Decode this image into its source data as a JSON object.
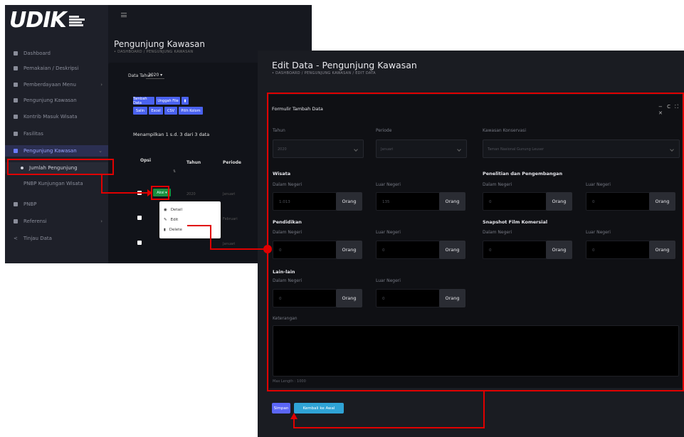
{
  "colors": {
    "accent": "#4a62f0",
    "annotation": "#e00000",
    "success": "#1a8f3e",
    "info": "#2fa3d6",
    "primary": "#5b66f5"
  },
  "bg": {
    "logo": "UDIK",
    "sidebar": [
      "Dashboard",
      "Pemakaian / Deskripsi",
      "Pemberdayaan Menu",
      "Pengunjung Kawasan",
      "Kontrib Masuk Wisata",
      "Fasilitas",
      "Pengunjung Kawasan",
      "Jumlah Pengunjung",
      "PNBP Kunjungan Wisata",
      "PNBP",
      "Referensi",
      "Tinjau Data"
    ],
    "page_title": "Pengunjung Kawasan",
    "breadcrumb": "• DASHBOARD / PENGUNJUNG KAWASAN",
    "year_label": "Data Tahun",
    "year_value": "2020 ▾",
    "buttons_row1": [
      "Tambah Data",
      "Unggah File"
    ],
    "buttons_row2": [
      "Salin",
      "Excel",
      "CSV",
      "Pilih Kolom"
    ],
    "showing": "Menampilkan 1 s.d. 3 dari 3 data",
    "table_headers": [
      "Opsi",
      "Tahun",
      "Periode"
    ],
    "aksi": "Aksi ▾",
    "dropdown": [
      {
        "icon": "eye-icon",
        "glyph": "◉",
        "label": "Detail"
      },
      {
        "icon": "pencil-icon",
        "glyph": "✎",
        "label": "Edit"
      },
      {
        "icon": "trash-icon",
        "glyph": "🗑",
        "label": "Delete"
      }
    ],
    "row_year": "2020",
    "row_period": [
      "Januari",
      "Februari",
      "Januari"
    ]
  },
  "modal": {
    "title": "Edit Data - Pengunjung Kawasan",
    "breadcrumb": "• DASHBOARD / PENGUNJUNG KAWASAN / EDIT DATA",
    "card_title": "Formulir Tambah Data",
    "card_tools": "− C ⛶ ✕",
    "fields": {
      "tahun": {
        "label": "Tahun",
        "value": "2020"
      },
      "periode": {
        "label": "Periode",
        "value": "Januari"
      },
      "kawasan": {
        "label": "Kawasan Konservasi",
        "value": "Taman Nasional Gunung Leuser"
      }
    },
    "sections": {
      "wisata": "Wisata",
      "penelitian": "Penelitian dan Pengembangan",
      "pendidikan": "Pendidikan",
      "film": "Snapshot Film Komersial",
      "lain": "Lain-lain"
    },
    "dn": "Dalam Negeri",
    "ln": "Luar Negeri",
    "unit": "Orang",
    "values": {
      "wisata_dn": "1.013",
      "wisata_ln": "135",
      "pen_dn": "0",
      "pen_ln": "0",
      "pend_dn": "0",
      "pend_ln": "0",
      "film_dn": "0",
      "film_ln": "0",
      "lain_dn": "0",
      "lain_ln": "0"
    },
    "keterangan_label": "Keterangan",
    "maxlen": "Max Length : 1000",
    "save": "Simpan",
    "back": "Kembali ke Awal"
  }
}
